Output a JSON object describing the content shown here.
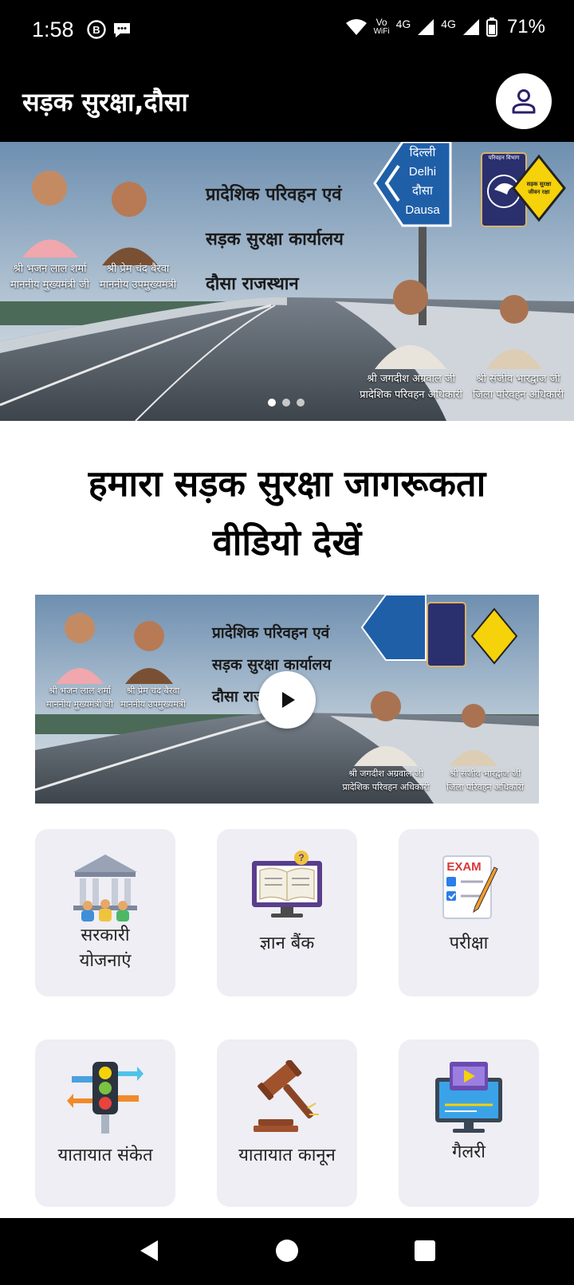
{
  "status_bar": {
    "time": "1:58",
    "network_small_top": "Vo",
    "network_small_bottom": "WiFi",
    "network_1": "4G",
    "network_2": "4G",
    "battery": "71%"
  },
  "app_bar": {
    "title": "सड़क सुरक्षा,दौसा",
    "profile_icon": "person-icon"
  },
  "banner": {
    "title_line_1": "प्रादेशिक परिवहन एवं",
    "title_line_2": "सड़क सुरक्षा कार्यालय",
    "title_line_3": "दौसा राजस्थान",
    "sign_line_1": "दिल्ली",
    "sign_line_2": "Delhi",
    "sign_line_3": "दौसा",
    "sign_line_4": "Dausa",
    "emblem_label": "परिवहन विभाग",
    "road_sign_text_1": "सड़क सुरक्षा",
    "road_sign_text_2": "जीवन रक्षा",
    "person1_name": "श्री भजन लाल शर्मा",
    "person1_role": "माननीय मुख्यमंत्री जी",
    "person2_name": "श्री प्रेम चंद बैरवा",
    "person2_role": "माननीय उपमुख्यमंत्री",
    "person3_name": "श्री जगदीश अग्रवाल जी",
    "person3_role": "प्रादेशिक परिवहन अधिकारी",
    "person4_name": "श्री संजीव भारद्वाज जी",
    "person4_role": "जिला परिवहन अधिकारी",
    "dots_count": 3,
    "active_dot": 1
  },
  "section": {
    "heading_line_1": "हमारा सड़क सुरक्षा जागरूकता",
    "heading_line_2": "वीडियो देखें"
  },
  "video": {
    "title_line_1": "प्रादेशिक परिवहन एवं",
    "title_line_2": "सड़क सुरक्षा कार्यालय",
    "title_line_3": "दौसा राजस्थान",
    "person1_name": "श्री भजन लाल शर्मा",
    "person1_role": "माननीय मुख्यमंत्री जी",
    "person2_name": "श्री प्रेम चंद बैरवा",
    "person2_role": "माननीय उपमुख्यमंत्री",
    "person3_name": "श्री जगदीश अग्रवाल जी",
    "person3_role": "प्रादेशिक परिवहन अधिकारी",
    "person4_name": "श्री संजीव भारद्वाज जी",
    "person4_role": "जिला परिवहन अधिकारी",
    "play_icon": "play-icon"
  },
  "cards": [
    {
      "label_1": "सरकारी",
      "label_2": "योजनाएं",
      "icon": "government-building-icon"
    },
    {
      "label_1": "ज्ञान बैंक",
      "icon": "knowledge-book-monitor-icon"
    },
    {
      "label_1": "परीक्षा",
      "icon": "exam-icon",
      "icon_text": "EXAM"
    },
    {
      "label_1": "यातायात संकेत",
      "icon": "traffic-signal-icon"
    },
    {
      "label_1": "यातायात कानून",
      "icon": "gavel-icon"
    },
    {
      "label_1": "गैलरी",
      "icon": "video-gallery-icon"
    }
  ],
  "nav_bar": {
    "back_icon": "back-triangle-icon",
    "home_icon": "home-circle-icon",
    "recents_icon": "recents-square-icon"
  }
}
